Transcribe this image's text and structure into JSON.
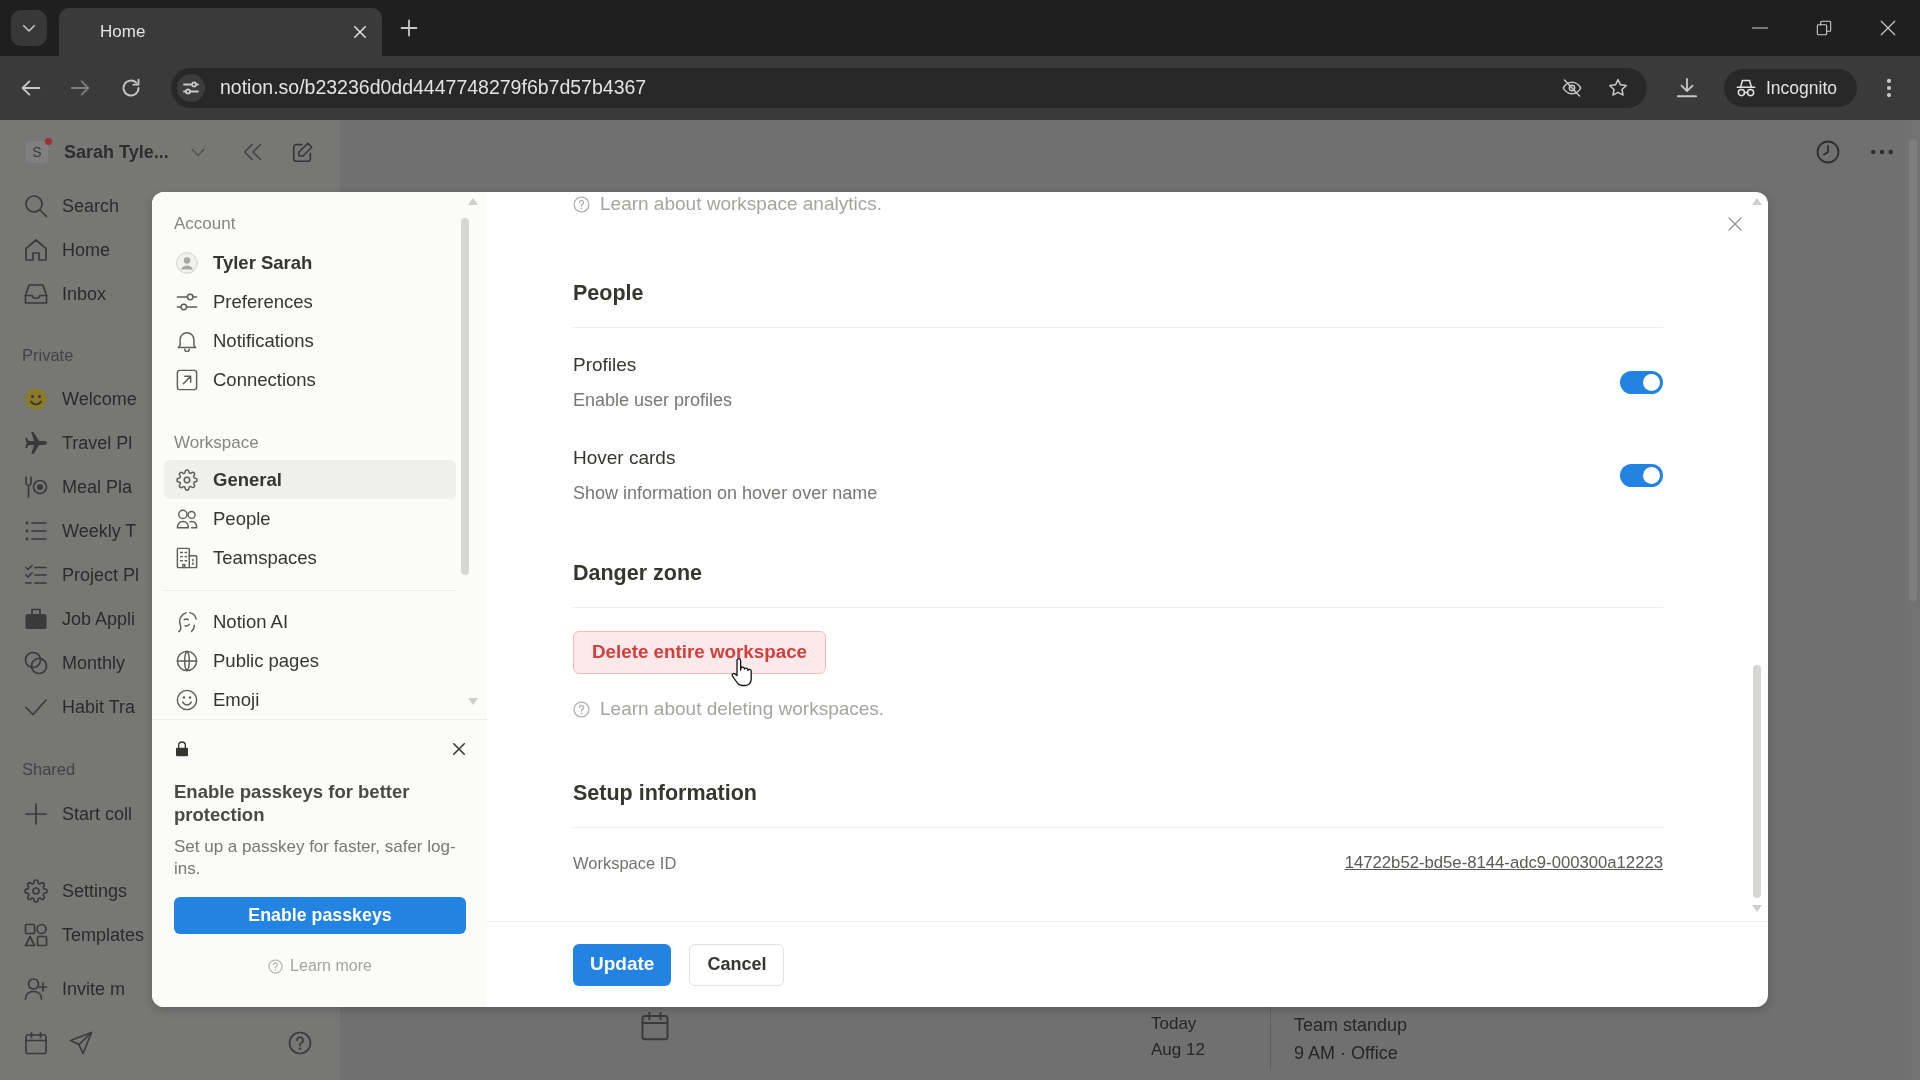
{
  "browser": {
    "tabs": [
      {
        "title": "Home",
        "selected": true
      }
    ],
    "url": "notion.so/b23236d0dd4447748279f6b7d57b4367",
    "profile_button": "Incognito"
  },
  "workspace_sidebar": {
    "workspace_initial": "S",
    "workspace_name": "Sarah Tyle...",
    "nav": [
      {
        "label": "Search"
      },
      {
        "label": "Home"
      },
      {
        "label": "Inbox"
      }
    ],
    "private_heading": "Private",
    "pages": [
      {
        "label": "Welcome"
      },
      {
        "label": "Travel Pl"
      },
      {
        "label": "Meal Pla"
      },
      {
        "label": "Weekly T"
      },
      {
        "label": "Project Pl"
      },
      {
        "label": "Job Appli"
      },
      {
        "label": "Monthly"
      },
      {
        "label": "Habit Tra"
      }
    ],
    "shared_heading": "Shared",
    "shared_items": [
      {
        "label": "Start coll"
      }
    ],
    "bottom_items": [
      {
        "label": "Settings"
      },
      {
        "label": "Templates"
      },
      {
        "label": "Invite m"
      }
    ]
  },
  "page": {
    "event": {
      "day": "Today",
      "date": "Aug 12",
      "title": "Team standup",
      "detail": "9 AM · Office"
    }
  },
  "settings_dialog": {
    "nav": {
      "sections": [
        {
          "heading": "Account",
          "items": [
            {
              "kind": "profile",
              "label": "Tyler Sarah",
              "selected": false
            },
            {
              "kind": "link",
              "label": "Preferences",
              "selected": false
            },
            {
              "kind": "link",
              "label": "Notifications",
              "selected": false
            },
            {
              "kind": "link",
              "label": "Connections",
              "selected": false
            }
          ]
        },
        {
          "heading": "Workspace",
          "items": [
            {
              "kind": "link",
              "label": "General",
              "selected": true
            },
            {
              "kind": "link",
              "label": "People",
              "selected": false
            },
            {
              "kind": "link",
              "label": "Teamspaces",
              "selected": false
            }
          ]
        },
        {
          "items": [
            {
              "kind": "link",
              "label": "Notion AI",
              "selected": false
            },
            {
              "kind": "link",
              "label": "Public pages",
              "selected": false
            },
            {
              "kind": "link",
              "label": "Emoji",
              "selected": false
            }
          ]
        }
      ]
    },
    "passkey_prompt": {
      "title": "Enable passkeys for better protection",
      "description": "Set up a passkey for faster, safer log-ins.",
      "button": "Enable passkeys",
      "link": "Learn more"
    },
    "content": {
      "help_link": "Learn about workspace analytics.",
      "sections": [
        {
          "kind": "toggles",
          "heading": "People",
          "settings": [
            {
              "label": "Profiles",
              "description": "Enable user profiles",
              "on": true
            },
            {
              "label": "Hover cards",
              "description": "Show information on hover over name",
              "on": true
            }
          ]
        },
        {
          "kind": "danger",
          "heading": "Danger zone",
          "button": "Delete entire workspace",
          "help": "Learn about deleting workspaces."
        },
        {
          "kind": "info",
          "heading": "Setup information",
          "fields": [
            {
              "label": "Workspace ID",
              "value": "14722b52-bd5e-8144-adc9-000300a12223"
            }
          ]
        }
      ]
    },
    "footer": {
      "buttons": [
        {
          "kind": "primary",
          "label": "Update"
        },
        {
          "kind": "secondary",
          "label": "Cancel"
        }
      ]
    }
  }
}
